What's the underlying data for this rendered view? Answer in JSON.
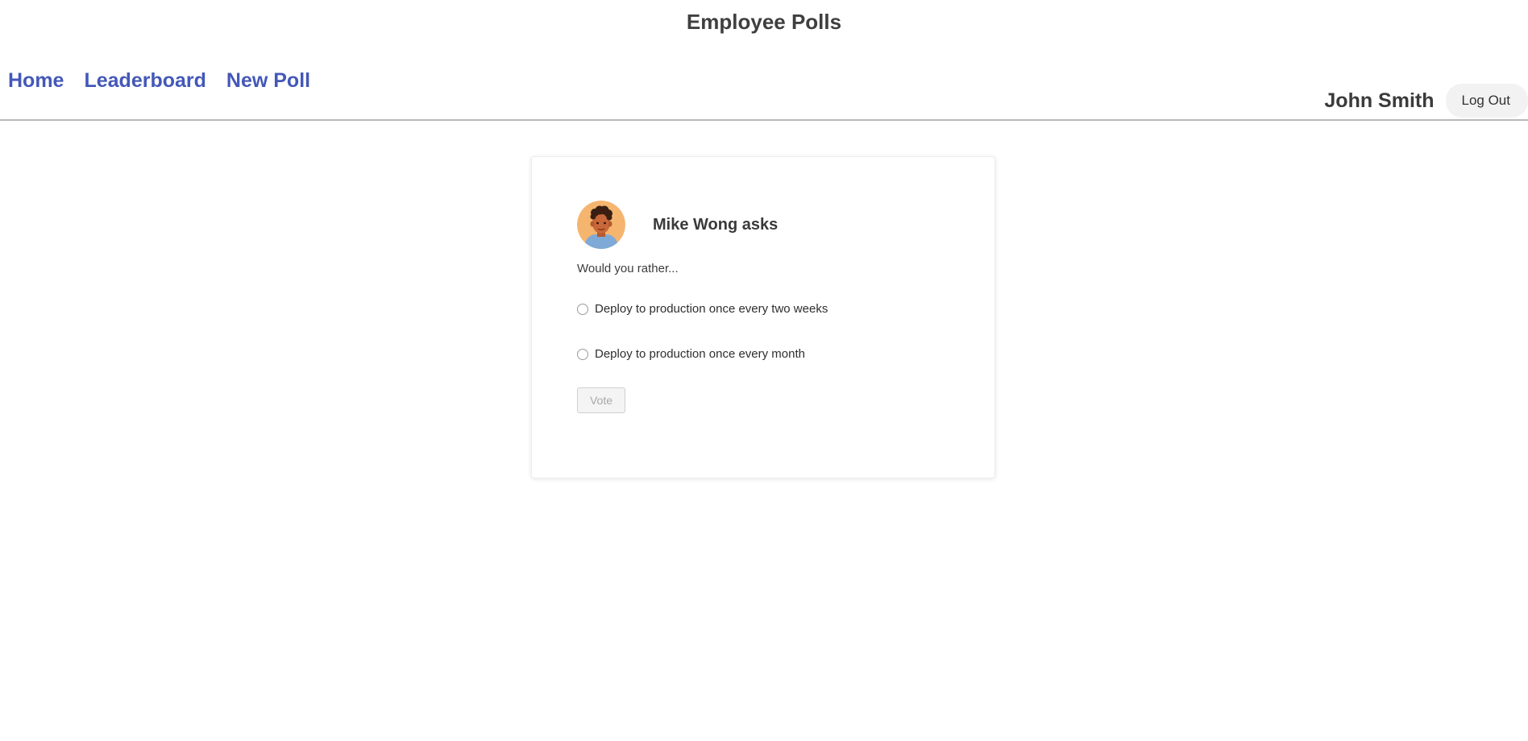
{
  "header": {
    "title": "Employee Polls"
  },
  "nav": {
    "items": [
      {
        "label": "Home"
      },
      {
        "label": "Leaderboard"
      },
      {
        "label": "New Poll"
      }
    ]
  },
  "user": {
    "name": "John Smith",
    "logout_label": "Log Out"
  },
  "poll": {
    "asker_label": "Mike Wong asks",
    "avatar_icon": "person-avatar-icon",
    "prompt": "Would you rather...",
    "options": [
      {
        "label": "Deploy to production once every two weeks",
        "selected": false
      },
      {
        "label": "Deploy to production once every month",
        "selected": false
      }
    ],
    "vote_label": "Vote",
    "vote_enabled": false
  },
  "colors": {
    "nav_link": "#4458b8",
    "avatar_bg": "#f5b56e",
    "avatar_shirt": "#7fa9d6"
  }
}
